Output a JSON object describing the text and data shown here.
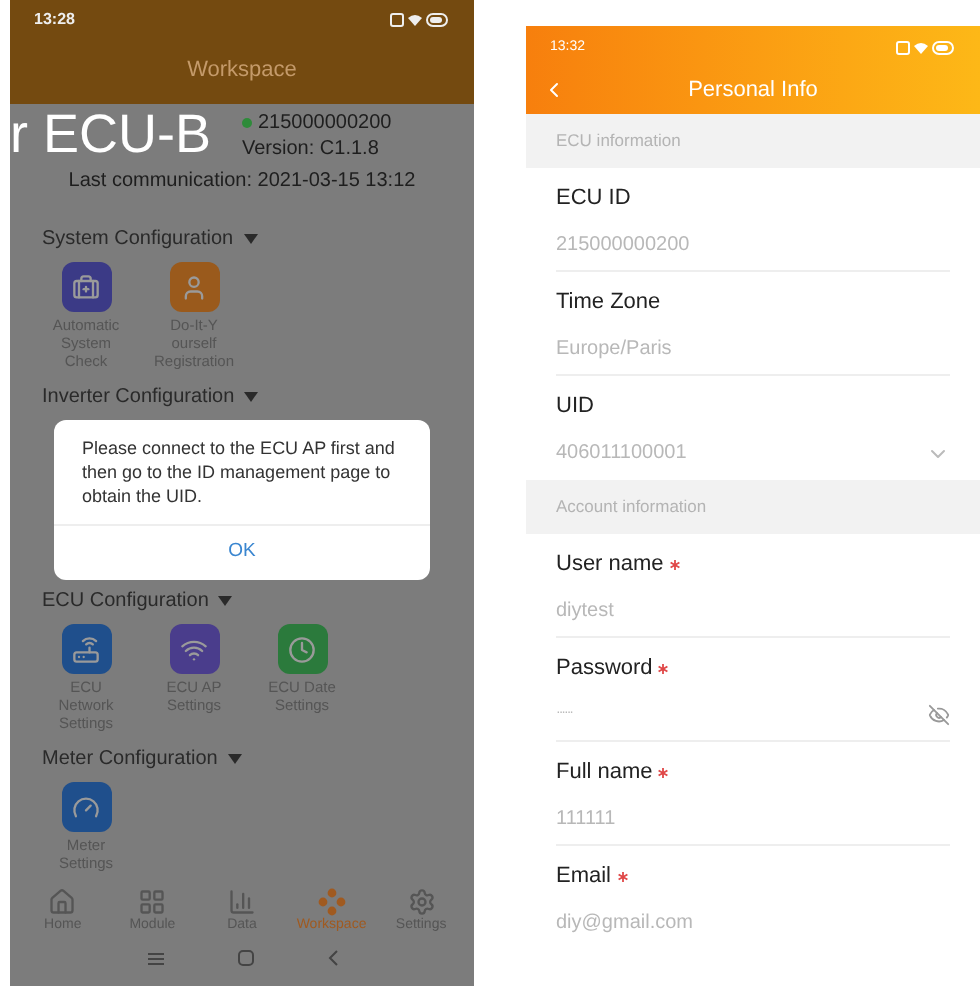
{
  "left_screen": {
    "status_time": "13:28",
    "title": "Workspace",
    "overlay_caption": "r ECU-B",
    "ecu_id": "215000000200",
    "version": "Version: C1.1.8",
    "last_communication": "Last communication: 2021-03-15 13:12",
    "sections": [
      {
        "title": "System Configuration",
        "expanded": true,
        "items": [
          {
            "label": "Automatic System Check",
            "color": "#3b3a86"
          },
          {
            "label": "Do-It-Y ourself Registration",
            "color": "#9a5a1c"
          }
        ]
      },
      {
        "title": "Inverter Configuration",
        "expanded": true
      },
      {
        "title": "ECU Configuration",
        "expanded": true,
        "items": [
          {
            "label": "ECU Network Settings",
            "color": "#1f4f8c"
          },
          {
            "label": "ECU AP Settings",
            "color": "#4a3d8c"
          },
          {
            "label": "ECU Date Settings",
            "color": "#2b7a3c"
          }
        ]
      },
      {
        "title": "Meter Configuration",
        "expanded": true,
        "items": [
          {
            "label": "Meter Settings",
            "color": "#1f4f8c"
          }
        ]
      }
    ],
    "dialog": {
      "message": "Please connect to the ECU AP first and then go to the ID management page to obtain the UID.",
      "button": "OK"
    },
    "bottom_nav": [
      {
        "label": "Home",
        "selected": false
      },
      {
        "label": "Module",
        "selected": false
      },
      {
        "label": "Data",
        "selected": false
      },
      {
        "label": "Workspace",
        "selected": true
      },
      {
        "label": "Settings",
        "selected": false
      }
    ]
  },
  "right_screen": {
    "status_time": "13:32",
    "title": "Personal Info",
    "sections": [
      {
        "title": "ECU information",
        "fields": [
          {
            "label": "ECU ID",
            "required": false,
            "value": "215000000200",
            "kind": "text"
          },
          {
            "label": "Time Zone",
            "required": false,
            "value": "Europe/Paris",
            "kind": "text"
          },
          {
            "label": "UID",
            "required": false,
            "value": "406011100001",
            "kind": "select"
          }
        ]
      },
      {
        "title": "Account information",
        "fields": [
          {
            "label": "User name",
            "required": true,
            "value": "diytest",
            "kind": "text"
          },
          {
            "label": "Password",
            "required": true,
            "value": "······",
            "kind": "password"
          },
          {
            "label": "Full name",
            "required": true,
            "value": "111111",
            "kind": "text"
          },
          {
            "label": "Email",
            "required": true,
            "value": "diy@gmail.com",
            "kind": "text"
          }
        ]
      }
    ]
  }
}
